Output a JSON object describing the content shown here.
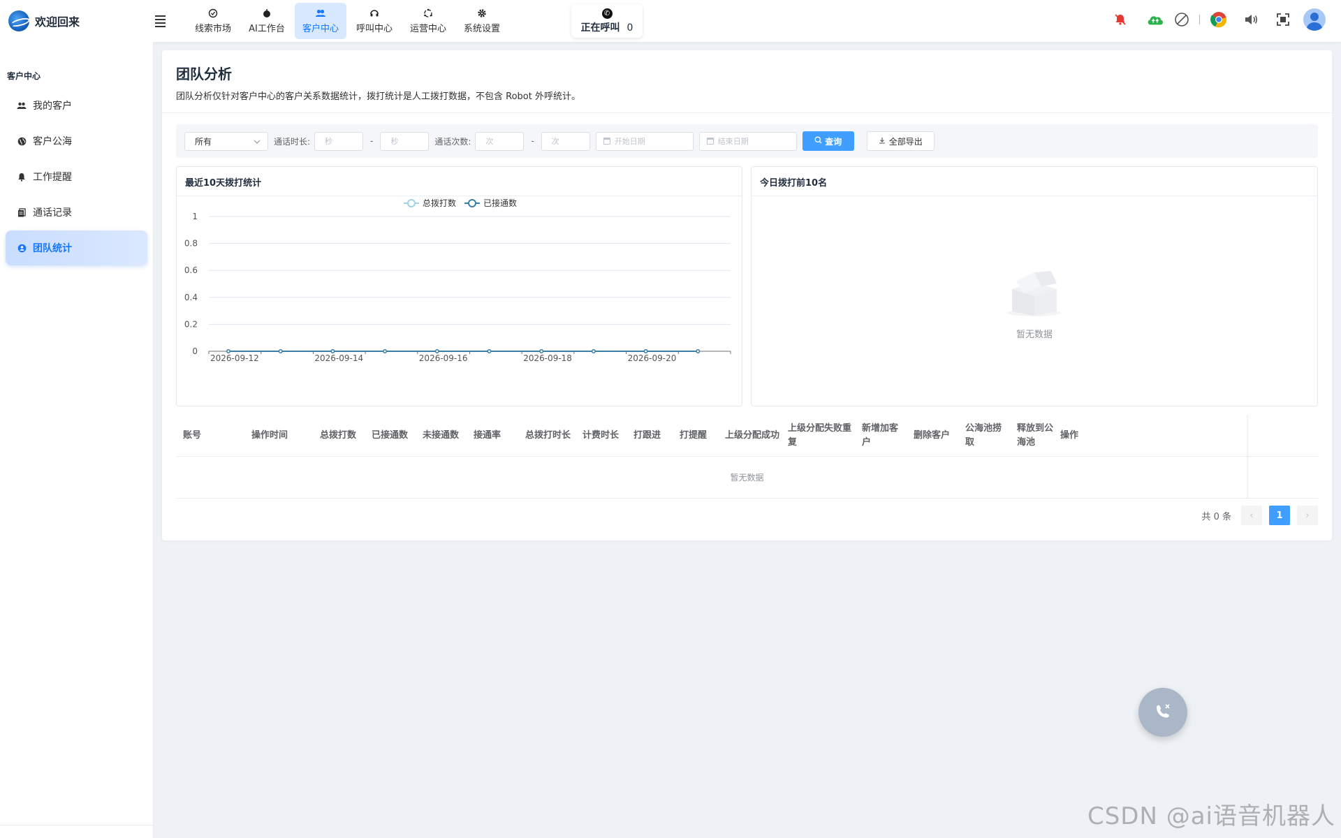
{
  "brand": {
    "title": "欢迎回来"
  },
  "nav": [
    {
      "label": "线索市场",
      "icon": "target-icon"
    },
    {
      "label": "AI工作台",
      "icon": "robot-icon"
    },
    {
      "label": "客户中心",
      "icon": "users-icon",
      "active": true
    },
    {
      "label": "呼叫中心",
      "icon": "headset-icon"
    },
    {
      "label": "运营中心",
      "icon": "cycle-icon"
    },
    {
      "label": "系统设置",
      "icon": "gear-icon"
    }
  ],
  "calling": {
    "label": "正在呼叫",
    "count": "0"
  },
  "sidebar": {
    "title": "客户中心",
    "items": [
      {
        "label": "我的客户",
        "icon": "users-icon"
      },
      {
        "label": "客户公海",
        "icon": "globe-icon"
      },
      {
        "label": "工作提醒",
        "icon": "bell-icon"
      },
      {
        "label": "通话记录",
        "icon": "record-icon"
      },
      {
        "label": "团队统计",
        "icon": "team-icon",
        "active": true
      }
    ]
  },
  "page": {
    "title": "团队分析",
    "desc": "团队分析仅针对客户中心的客户关系数据统计，拨打统计是人工拨打数据，不包含 Robot 外呼统计。"
  },
  "filters": {
    "select_value": "所有",
    "duration_label": "通话时长:",
    "duration_min_ph": "秒",
    "duration_max_ph": "秒",
    "count_label": "通话次数:",
    "count_min_ph": "次",
    "count_max_ph": "次",
    "dash": "-",
    "start_date_ph": "开始日期",
    "end_date_ph": "结束日期",
    "query_btn": "查询",
    "export_btn": "全部导出"
  },
  "left_panel": {
    "title": "最近10天拨打统计"
  },
  "right_panel": {
    "title": "今日拨打前10名",
    "empty_text": "暂无数据"
  },
  "chart_data": {
    "type": "line",
    "title": "",
    "xlabel": "",
    "ylabel": "",
    "x": [
      "2026-09-12",
      "2026-09-13",
      "2026-09-14",
      "2026-09-15",
      "2026-09-16",
      "2026-09-17",
      "2026-09-18",
      "2026-09-19",
      "2026-09-20",
      "2026-09-21"
    ],
    "x_tick_labels": [
      "2026-09-12",
      "2026-09-14",
      "2026-09-16",
      "2026-09-18",
      "2026-09-20"
    ],
    "y_ticks": [
      "0",
      "0.2",
      "0.4",
      "0.6",
      "0.8",
      "1"
    ],
    "ylim": [
      0,
      1
    ],
    "grid": true,
    "legend_position": "top-center",
    "series": [
      {
        "name": "总拨打数",
        "color": "#9fd3e8",
        "values": [
          0,
          0,
          0,
          0,
          0,
          0,
          0,
          0,
          0,
          0
        ]
      },
      {
        "name": "已接通数",
        "color": "#3a7fa5",
        "values": [
          0,
          0,
          0,
          0,
          0,
          0,
          0,
          0,
          0,
          0
        ]
      }
    ]
  },
  "table": {
    "columns": [
      "账号",
      "操作时间",
      "总拨打数",
      "已接通数",
      "未接通数",
      "接通率",
      "总拨打时长",
      "计费时长",
      "打跟进",
      "打提醒",
      "上级分配成功",
      "上级分配失败重复",
      "新增加客户",
      "删除客户",
      "公海池捞取",
      "释放到公海池",
      "操作"
    ],
    "empty_text": "暂无数据"
  },
  "pagination": {
    "total_text": "共 0 条",
    "current": "1",
    "prev": "‹",
    "next": "›"
  },
  "watermark": "CSDN @ai语音机器人"
}
